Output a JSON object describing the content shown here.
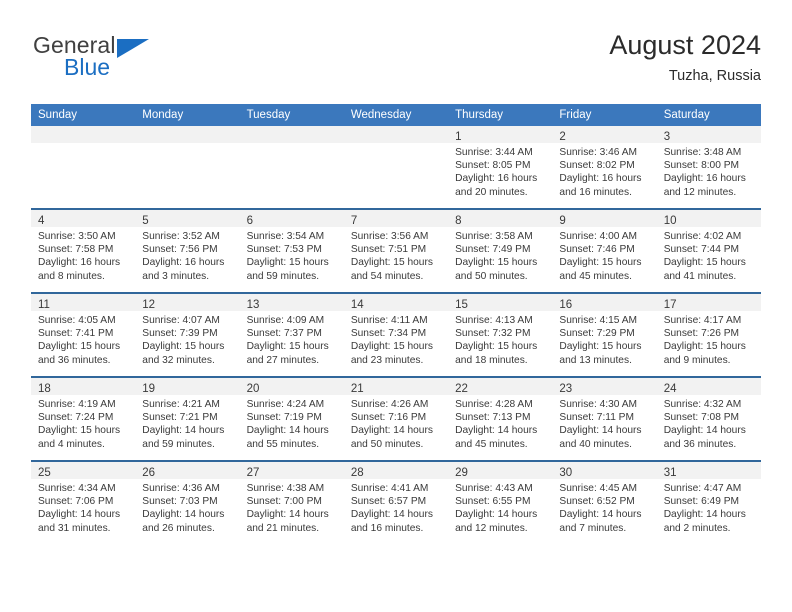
{
  "brand": {
    "name_top": "General",
    "name_bottom": "Blue",
    "triangle_color": "#1b6ec2",
    "text_color": "#404040"
  },
  "header": {
    "title": "August 2024",
    "subtitle": "Tuzha, Russia"
  },
  "theme": {
    "header_row_bg": "#3b78bd",
    "header_row_text": "#ffffff",
    "row_separator": "#31679b",
    "daynum_band_bg": "#f2f2f2",
    "body_text": "#3a3a3a"
  },
  "weekdays": [
    "Sunday",
    "Monday",
    "Tuesday",
    "Wednesday",
    "Thursday",
    "Friday",
    "Saturday"
  ],
  "labels": {
    "sunrise_prefix": "Sunrise:",
    "sunset_prefix": "Sunset:",
    "daylight_prefix": "Daylight:"
  },
  "weeks": [
    [
      {
        "day": "",
        "empty": true
      },
      {
        "day": "",
        "empty": true
      },
      {
        "day": "",
        "empty": true
      },
      {
        "day": "",
        "empty": true
      },
      {
        "day": "1",
        "sunrise": "Sunrise: 3:44 AM",
        "sunset": "Sunset: 8:05 PM",
        "daylight_1": "Daylight: 16 hours",
        "daylight_2": "and 20 minutes."
      },
      {
        "day": "2",
        "sunrise": "Sunrise: 3:46 AM",
        "sunset": "Sunset: 8:02 PM",
        "daylight_1": "Daylight: 16 hours",
        "daylight_2": "and 16 minutes."
      },
      {
        "day": "3",
        "sunrise": "Sunrise: 3:48 AM",
        "sunset": "Sunset: 8:00 PM",
        "daylight_1": "Daylight: 16 hours",
        "daylight_2": "and 12 minutes."
      }
    ],
    [
      {
        "day": "4",
        "sunrise": "Sunrise: 3:50 AM",
        "sunset": "Sunset: 7:58 PM",
        "daylight_1": "Daylight: 16 hours",
        "daylight_2": "and 8 minutes."
      },
      {
        "day": "5",
        "sunrise": "Sunrise: 3:52 AM",
        "sunset": "Sunset: 7:56 PM",
        "daylight_1": "Daylight: 16 hours",
        "daylight_2": "and 3 minutes."
      },
      {
        "day": "6",
        "sunrise": "Sunrise: 3:54 AM",
        "sunset": "Sunset: 7:53 PM",
        "daylight_1": "Daylight: 15 hours",
        "daylight_2": "and 59 minutes."
      },
      {
        "day": "7",
        "sunrise": "Sunrise: 3:56 AM",
        "sunset": "Sunset: 7:51 PM",
        "daylight_1": "Daylight: 15 hours",
        "daylight_2": "and 54 minutes."
      },
      {
        "day": "8",
        "sunrise": "Sunrise: 3:58 AM",
        "sunset": "Sunset: 7:49 PM",
        "daylight_1": "Daylight: 15 hours",
        "daylight_2": "and 50 minutes."
      },
      {
        "day": "9",
        "sunrise": "Sunrise: 4:00 AM",
        "sunset": "Sunset: 7:46 PM",
        "daylight_1": "Daylight: 15 hours",
        "daylight_2": "and 45 minutes."
      },
      {
        "day": "10",
        "sunrise": "Sunrise: 4:02 AM",
        "sunset": "Sunset: 7:44 PM",
        "daylight_1": "Daylight: 15 hours",
        "daylight_2": "and 41 minutes."
      }
    ],
    [
      {
        "day": "11",
        "sunrise": "Sunrise: 4:05 AM",
        "sunset": "Sunset: 7:41 PM",
        "daylight_1": "Daylight: 15 hours",
        "daylight_2": "and 36 minutes."
      },
      {
        "day": "12",
        "sunrise": "Sunrise: 4:07 AM",
        "sunset": "Sunset: 7:39 PM",
        "daylight_1": "Daylight: 15 hours",
        "daylight_2": "and 32 minutes."
      },
      {
        "day": "13",
        "sunrise": "Sunrise: 4:09 AM",
        "sunset": "Sunset: 7:37 PM",
        "daylight_1": "Daylight: 15 hours",
        "daylight_2": "and 27 minutes."
      },
      {
        "day": "14",
        "sunrise": "Sunrise: 4:11 AM",
        "sunset": "Sunset: 7:34 PM",
        "daylight_1": "Daylight: 15 hours",
        "daylight_2": "and 23 minutes."
      },
      {
        "day": "15",
        "sunrise": "Sunrise: 4:13 AM",
        "sunset": "Sunset: 7:32 PM",
        "daylight_1": "Daylight: 15 hours",
        "daylight_2": "and 18 minutes."
      },
      {
        "day": "16",
        "sunrise": "Sunrise: 4:15 AM",
        "sunset": "Sunset: 7:29 PM",
        "daylight_1": "Daylight: 15 hours",
        "daylight_2": "and 13 minutes."
      },
      {
        "day": "17",
        "sunrise": "Sunrise: 4:17 AM",
        "sunset": "Sunset: 7:26 PM",
        "daylight_1": "Daylight: 15 hours",
        "daylight_2": "and 9 minutes."
      }
    ],
    [
      {
        "day": "18",
        "sunrise": "Sunrise: 4:19 AM",
        "sunset": "Sunset: 7:24 PM",
        "daylight_1": "Daylight: 15 hours",
        "daylight_2": "and 4 minutes."
      },
      {
        "day": "19",
        "sunrise": "Sunrise: 4:21 AM",
        "sunset": "Sunset: 7:21 PM",
        "daylight_1": "Daylight: 14 hours",
        "daylight_2": "and 59 minutes."
      },
      {
        "day": "20",
        "sunrise": "Sunrise: 4:24 AM",
        "sunset": "Sunset: 7:19 PM",
        "daylight_1": "Daylight: 14 hours",
        "daylight_2": "and 55 minutes."
      },
      {
        "day": "21",
        "sunrise": "Sunrise: 4:26 AM",
        "sunset": "Sunset: 7:16 PM",
        "daylight_1": "Daylight: 14 hours",
        "daylight_2": "and 50 minutes."
      },
      {
        "day": "22",
        "sunrise": "Sunrise: 4:28 AM",
        "sunset": "Sunset: 7:13 PM",
        "daylight_1": "Daylight: 14 hours",
        "daylight_2": "and 45 minutes."
      },
      {
        "day": "23",
        "sunrise": "Sunrise: 4:30 AM",
        "sunset": "Sunset: 7:11 PM",
        "daylight_1": "Daylight: 14 hours",
        "daylight_2": "and 40 minutes."
      },
      {
        "day": "24",
        "sunrise": "Sunrise: 4:32 AM",
        "sunset": "Sunset: 7:08 PM",
        "daylight_1": "Daylight: 14 hours",
        "daylight_2": "and 36 minutes."
      }
    ],
    [
      {
        "day": "25",
        "sunrise": "Sunrise: 4:34 AM",
        "sunset": "Sunset: 7:06 PM",
        "daylight_1": "Daylight: 14 hours",
        "daylight_2": "and 31 minutes."
      },
      {
        "day": "26",
        "sunrise": "Sunrise: 4:36 AM",
        "sunset": "Sunset: 7:03 PM",
        "daylight_1": "Daylight: 14 hours",
        "daylight_2": "and 26 minutes."
      },
      {
        "day": "27",
        "sunrise": "Sunrise: 4:38 AM",
        "sunset": "Sunset: 7:00 PM",
        "daylight_1": "Daylight: 14 hours",
        "daylight_2": "and 21 minutes."
      },
      {
        "day": "28",
        "sunrise": "Sunrise: 4:41 AM",
        "sunset": "Sunset: 6:57 PM",
        "daylight_1": "Daylight: 14 hours",
        "daylight_2": "and 16 minutes."
      },
      {
        "day": "29",
        "sunrise": "Sunrise: 4:43 AM",
        "sunset": "Sunset: 6:55 PM",
        "daylight_1": "Daylight: 14 hours",
        "daylight_2": "and 12 minutes."
      },
      {
        "day": "30",
        "sunrise": "Sunrise: 4:45 AM",
        "sunset": "Sunset: 6:52 PM",
        "daylight_1": "Daylight: 14 hours",
        "daylight_2": "and 7 minutes."
      },
      {
        "day": "31",
        "sunrise": "Sunrise: 4:47 AM",
        "sunset": "Sunset: 6:49 PM",
        "daylight_1": "Daylight: 14 hours",
        "daylight_2": "and 2 minutes."
      }
    ]
  ]
}
